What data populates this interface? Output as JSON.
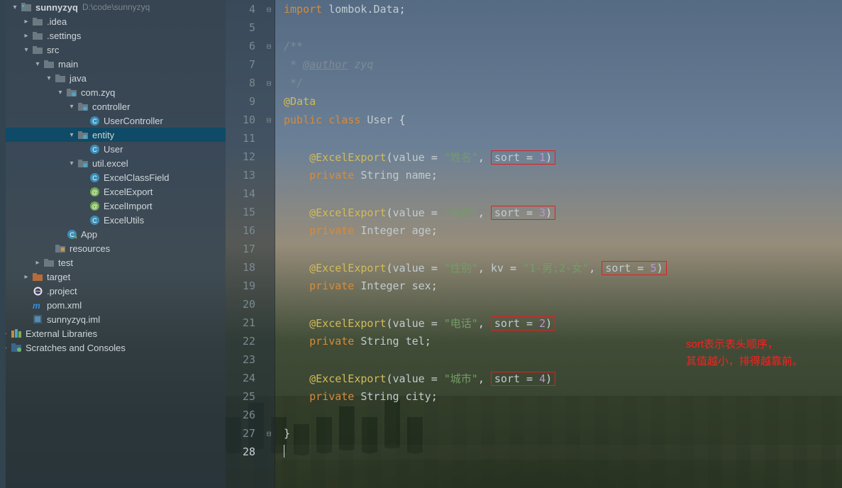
{
  "sidebar": {
    "root": {
      "name": "sunnyzyq",
      "path": "D:\\code\\sunnyzyq"
    },
    "nodes": [
      {
        "d": 1,
        "c": "right",
        "ic": "folder",
        "lbl": ".idea"
      },
      {
        "d": 1,
        "c": "right",
        "ic": "folder",
        "lbl": ".settings"
      },
      {
        "d": 1,
        "c": "down",
        "ic": "folder",
        "lbl": "src"
      },
      {
        "d": 2,
        "c": "down",
        "ic": "folder",
        "lbl": "main"
      },
      {
        "d": 3,
        "c": "down",
        "ic": "folder",
        "lbl": "java"
      },
      {
        "d": 4,
        "c": "down",
        "ic": "pkg",
        "lbl": "com.zyq"
      },
      {
        "d": 5,
        "c": "down",
        "ic": "pkg",
        "lbl": "controller"
      },
      {
        "d": 6,
        "c": "",
        "ic": "cls",
        "lbl": "UserController"
      },
      {
        "d": 5,
        "c": "down",
        "ic": "pkg",
        "lbl": "entity",
        "sel": true
      },
      {
        "d": 6,
        "c": "",
        "ic": "cls",
        "lbl": "User"
      },
      {
        "d": 5,
        "c": "down",
        "ic": "pkg",
        "lbl": "util.excel"
      },
      {
        "d": 6,
        "c": "",
        "ic": "cls",
        "lbl": "ExcelClassField"
      },
      {
        "d": 6,
        "c": "",
        "ic": "annG",
        "lbl": "ExcelExport"
      },
      {
        "d": 6,
        "c": "",
        "ic": "annG",
        "lbl": "ExcelImport"
      },
      {
        "d": 6,
        "c": "",
        "ic": "cls",
        "lbl": "ExcelUtils"
      },
      {
        "d": 4,
        "c": "",
        "ic": "clsC",
        "lbl": "App"
      },
      {
        "d": 3,
        "c": "",
        "ic": "res",
        "lbl": "resources"
      },
      {
        "d": 2,
        "c": "right",
        "ic": "folder",
        "lbl": "test"
      },
      {
        "d": 1,
        "c": "right",
        "ic": "target",
        "lbl": "target"
      },
      {
        "d": 1,
        "c": "",
        "ic": "ecl",
        "lbl": ".project"
      },
      {
        "d": 1,
        "c": "",
        "ic": "mvn",
        "lbl": "pom.xml"
      },
      {
        "d": 1,
        "c": "",
        "ic": "iml",
        "lbl": "sunnyzyq.iml"
      }
    ],
    "extlib": "External Libraries",
    "scratch": "Scratches and Consoles"
  },
  "note": {
    "l1": "sort表示表头顺序，",
    "l2": "其值越小，排得越靠前。"
  },
  "code": {
    "pkg": "lombok",
    "cls": "Data",
    "author_tag": "@author",
    "author": "zyq",
    "data_ann": "@Data",
    "kw_public": "public",
    "kw_class": "class",
    "kw_private": "private",
    "class_name": "User",
    "excel_ann": "@ExcelExport",
    "p_value": "value",
    "p_sort": "sort",
    "p_kv": "kv",
    "ty_String": "String",
    "ty_Integer": "Integer",
    "f_name": {
      "zh": "\"姓名\"",
      "sort": "1",
      "id": "name"
    },
    "f_age": {
      "zh": "\"年龄\"",
      "sort": "3",
      "id": "age"
    },
    "f_sex": {
      "zh": "\"性别\"",
      "kv": "\"1-男;2-女\"",
      "sort": "5",
      "id": "sex"
    },
    "f_tel": {
      "zh": "\"电话\"",
      "sort": "2",
      "id": "tel"
    },
    "f_city": {
      "zh": "\"城市\"",
      "sort": "4",
      "id": "city"
    }
  },
  "lines": [
    "4",
    "5",
    "6",
    "7",
    "8",
    "9",
    "10",
    "11",
    "12",
    "13",
    "14",
    "15",
    "16",
    "17",
    "18",
    "19",
    "20",
    "21",
    "22",
    "23",
    "24",
    "25",
    "26",
    "27",
    "28"
  ]
}
